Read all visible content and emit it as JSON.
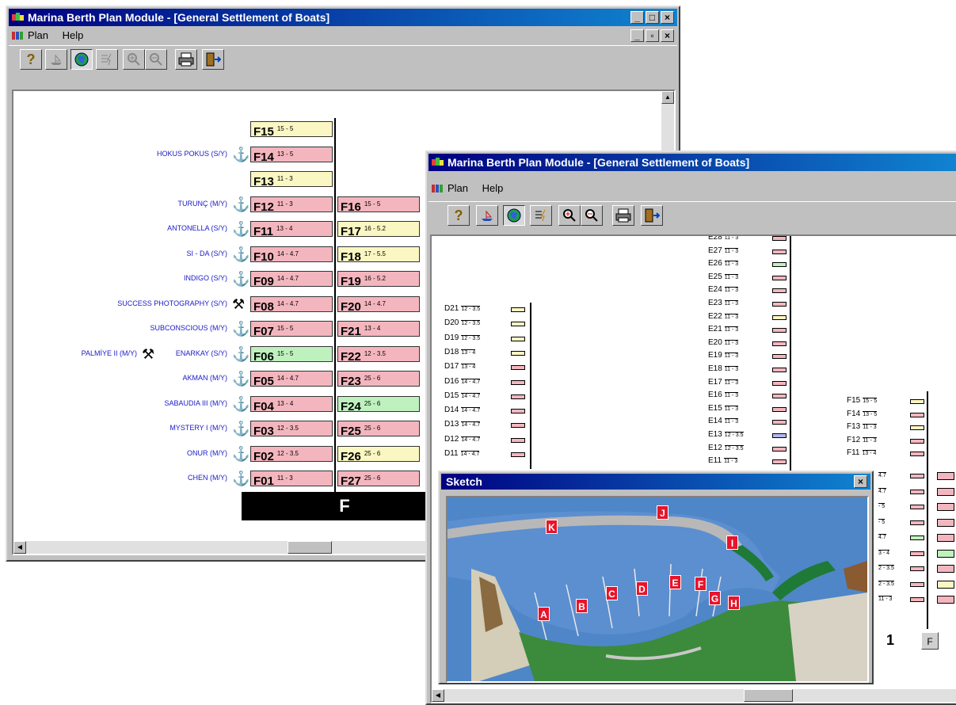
{
  "window1": {
    "title": "Marina Berth Plan Module - [General Settlement of Boats]",
    "menu": [
      "Plan",
      "Help"
    ],
    "pier_label": "F",
    "left_berths": [
      {
        "id": "F15",
        "size": "15 - 5",
        "boat": "",
        "color": "yellow",
        "icon": ""
      },
      {
        "id": "F14",
        "size": "13 - 5",
        "boat": "HOKUS POKUS (S/Y)",
        "color": "pink",
        "icon": "anchor"
      },
      {
        "id": "F13",
        "size": "11 - 3",
        "boat": "",
        "color": "yellow",
        "icon": ""
      },
      {
        "id": "F12",
        "size": "11 - 3",
        "boat": "TURUNÇ (M/Y)",
        "color": "pink",
        "icon": "anchor"
      },
      {
        "id": "F11",
        "size": "13 - 4",
        "boat": "ANTONELLA (S/Y)",
        "color": "pink",
        "icon": "anchor"
      },
      {
        "id": "F10",
        "size": "14 - 4.7",
        "boat": "SI - DA (S/Y)",
        "color": "pink",
        "icon": "anchor"
      },
      {
        "id": "F09",
        "size": "14 - 4.7",
        "boat": "INDIGO (S/Y)",
        "color": "pink",
        "icon": "anchor"
      },
      {
        "id": "F08",
        "size": "14 - 4.7",
        "boat": "SUCCESS PHOTOGRAPHY (S/Y)",
        "color": "pink",
        "icon": "hammer"
      },
      {
        "id": "F07",
        "size": "15 - 5",
        "boat": "SUBCONSCIOUS (M/Y)",
        "color": "pink",
        "icon": "anchor"
      },
      {
        "id": "F06",
        "size": "15 - 5",
        "boat": "PALMİYE II (M/Y)",
        "boat2": "ENARKAY (S/Y)",
        "color": "green",
        "icon": "anchor"
      },
      {
        "id": "F05",
        "size": "14 - 4.7",
        "boat": "AKMAN (M/Y)",
        "color": "pink",
        "icon": "anchor"
      },
      {
        "id": "F04",
        "size": "13 - 4",
        "boat": "SABAUDIA III (M/Y)",
        "color": "pink",
        "icon": "anchor"
      },
      {
        "id": "F03",
        "size": "12 - 3.5",
        "boat": "MYSTERY I (M/Y)",
        "color": "pink",
        "icon": "anchor"
      },
      {
        "id": "F02",
        "size": "12 - 3.5",
        "boat": "ONUR (M/Y)",
        "color": "pink",
        "icon": "anchor"
      },
      {
        "id": "F01",
        "size": "11 - 3",
        "boat": "CHEN (M/Y)",
        "color": "pink",
        "icon": "anchor"
      }
    ],
    "right_berths": [
      {
        "id": "F16",
        "size": "15 - 5",
        "color": "pink"
      },
      {
        "id": "F17",
        "size": "16 - 5.2",
        "color": "yellow"
      },
      {
        "id": "F18",
        "size": "17 - 5.5",
        "color": "yellow"
      },
      {
        "id": "F19",
        "size": "16 - 5.2",
        "color": "pink"
      },
      {
        "id": "F20",
        "size": "14 - 4.7",
        "color": "pink"
      },
      {
        "id": "F21",
        "size": "13 - 4",
        "color": "pink"
      },
      {
        "id": "F22",
        "size": "12 - 3.5",
        "color": "pink"
      },
      {
        "id": "F23",
        "size": "25 - 6",
        "color": "pink"
      },
      {
        "id": "F24",
        "size": "25 - 6",
        "color": "green"
      },
      {
        "id": "F25",
        "size": "25 - 6",
        "color": "pink"
      },
      {
        "id": "F26",
        "size": "25 - 6",
        "color": "yellow"
      },
      {
        "id": "F27",
        "size": "25 - 6",
        "color": "pink"
      }
    ]
  },
  "window2": {
    "title": "Marina Berth Plan Module - [General Settlement of Boats]",
    "menu": [
      "Plan",
      "Help"
    ],
    "d_berths": [
      {
        "id": "D21",
        "size": "12 - 3.5",
        "color": "yellow"
      },
      {
        "id": "D20",
        "size": "12 - 3.5",
        "color": "yellow"
      },
      {
        "id": "D19",
        "size": "12 - 3.5",
        "color": "yellow"
      },
      {
        "id": "D18",
        "size": "13 - 4",
        "color": "yellow"
      },
      {
        "id": "D17",
        "size": "13 - 4",
        "color": "pink"
      },
      {
        "id": "D16",
        "size": "14 - 4.7",
        "color": "pink"
      },
      {
        "id": "D15",
        "size": "14 - 4.7",
        "color": "pink"
      },
      {
        "id": "D14",
        "size": "14 - 4.7",
        "color": "pink"
      },
      {
        "id": "D13",
        "size": "14 - 4.7",
        "color": "pink"
      },
      {
        "id": "D12",
        "size": "14 - 4.7",
        "color": "pink"
      },
      {
        "id": "D11",
        "size": "14 - 4.7",
        "color": "pink"
      }
    ],
    "e_berths": [
      {
        "id": "E28",
        "size": "11 - 3",
        "color": "pink"
      },
      {
        "id": "E27",
        "size": "11 - 3",
        "color": "pink"
      },
      {
        "id": "E26",
        "size": "11 - 3",
        "color": "green"
      },
      {
        "id": "E25",
        "size": "11 - 3",
        "color": "pink"
      },
      {
        "id": "E24",
        "size": "11 - 3",
        "color": "pink"
      },
      {
        "id": "E23",
        "size": "11 - 3",
        "color": "pink"
      },
      {
        "id": "E22",
        "size": "11 - 3",
        "color": "yellow"
      },
      {
        "id": "E21",
        "size": "11 - 3",
        "color": "pink"
      },
      {
        "id": "E20",
        "size": "11 - 3",
        "color": "pink"
      },
      {
        "id": "E19",
        "size": "11 - 3",
        "color": "pink"
      },
      {
        "id": "E18",
        "size": "11 - 3",
        "color": "pink"
      },
      {
        "id": "E17",
        "size": "11 - 3",
        "color": "pink"
      },
      {
        "id": "E16",
        "size": "11 - 3",
        "color": "pink"
      },
      {
        "id": "E15",
        "size": "11 - 3",
        "color": "pink"
      },
      {
        "id": "E14",
        "size": "11 - 3",
        "color": "pink"
      },
      {
        "id": "E13",
        "size": "12 - 3.5",
        "color": "blue"
      },
      {
        "id": "E12",
        "size": "12 - 3.5",
        "color": "pink"
      },
      {
        "id": "E11",
        "size": "11 - 3",
        "color": "pink"
      }
    ],
    "f_berths": [
      {
        "id": "F15",
        "size": "15 - 5",
        "color": "yellow"
      },
      {
        "id": "F14",
        "size": "13 - 5",
        "color": "pink"
      },
      {
        "id": "F13",
        "size": "11 - 3",
        "color": "yellow"
      },
      {
        "id": "F12",
        "size": "11 - 3",
        "color": "pink"
      },
      {
        "id": "F11",
        "size": "13 - 4",
        "color": "pink"
      }
    ],
    "f_partial_sizes": [
      "4.7",
      "4.7",
      "- 5",
      "- 5",
      "4.7",
      "3 - 4",
      "2 - 3.5",
      "2 - 3.5",
      "11 - 3"
    ],
    "page_number": "1",
    "nav_button": "F"
  },
  "sketch": {
    "title": "Sketch",
    "markers": [
      "A",
      "B",
      "C",
      "D",
      "E",
      "F",
      "G",
      "H",
      "I",
      "J",
      "K"
    ]
  },
  "colors": {
    "pink": "#f4b6be",
    "yellow": "#fbf7c2",
    "green": "#bff1bf",
    "blue": "#b0b8f0",
    "title": "#000080"
  }
}
